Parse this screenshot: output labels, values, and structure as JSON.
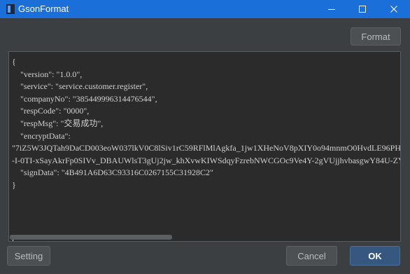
{
  "window": {
    "title": "GsonFormat",
    "minimize_icon": "minimize-icon",
    "maximize_icon": "maximize-icon",
    "close_icon": "close-icon"
  },
  "toolbar": {
    "format_label": "Format"
  },
  "editor": {
    "lines": [
      "{",
      "    \"version\": \"1.0.0\",",
      "    \"service\": \"service.customer.register\",",
      "    \"companyNo\": \"385449996314476544\",",
      "    \"respCode\": \"0000\",",
      "    \"respMsg\": \"交易成功\",",
      "    \"encryptData\":",
      "\"7iZ5W3JQTah9DaCD003eoW037lkV0C8lSiv1rC59RFlMlAgkfa_1jw1XHeNoV8pXIY0o94mnmO0HvdLE96PH",
      "-I-0TI-xSayAkrFp0SIVv_DBAUWlsT3gUj2jw_khXvwKIWSdqyFzrebNWCGOc9Ve4Y-2gVUjjhvbasgwY84U-ZY",
      "    \"signData\": \"4B491A6D63C93316C0267155C31928C2\"",
      "}"
    ]
  },
  "footer": {
    "setting_label": "Setting",
    "cancel_label": "Cancel",
    "ok_label": "OK"
  }
}
